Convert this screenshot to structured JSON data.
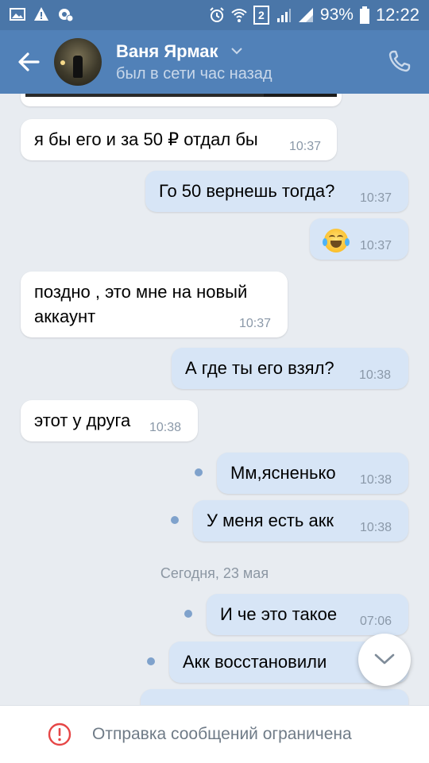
{
  "status_bar": {
    "battery": "93%",
    "time": "12:22",
    "sim": "2",
    "icons_left": [
      "image-icon",
      "warning-icon",
      "settings-icon"
    ],
    "icons_right": [
      "alarm-icon",
      "wifi-icon",
      "signal-icon",
      "battery-icon"
    ]
  },
  "header": {
    "name": "Ваня Ярмак",
    "status": "был в сети час назад",
    "accent": "#5181b8"
  },
  "messages": [
    {
      "dir": "in",
      "text": "я бы его и за 50 ₽ отдал бы",
      "time": "10:37"
    },
    {
      "dir": "out",
      "text": "Го 50 вернешь тогда?",
      "time": "10:37"
    },
    {
      "dir": "out",
      "emoji": "face-with-tears-of-joy",
      "time": "10:37"
    },
    {
      "dir": "in",
      "text": "поздно , это мне на новый\nаккаунт",
      "time": "10:37"
    },
    {
      "dir": "out",
      "text": "А где ты его взял?",
      "time": "10:38"
    },
    {
      "dir": "in",
      "text": "этот у друга",
      "time": "10:38"
    },
    {
      "dir": "out",
      "text": "Мм,ясненько",
      "time": "10:38",
      "unread": true
    },
    {
      "dir": "out",
      "text": "У меня есть акк",
      "time": "10:38",
      "unread": true
    },
    {
      "dir": "out",
      "text": "И че это такое",
      "time": "07:06",
      "unread": true
    },
    {
      "dir": "out",
      "text": "Акк восстановили",
      "unread": true
    }
  ],
  "date_separator": "Сегодня, 23 мая",
  "bottom": {
    "restriction_text": "Отправка сообщений ограничена"
  }
}
